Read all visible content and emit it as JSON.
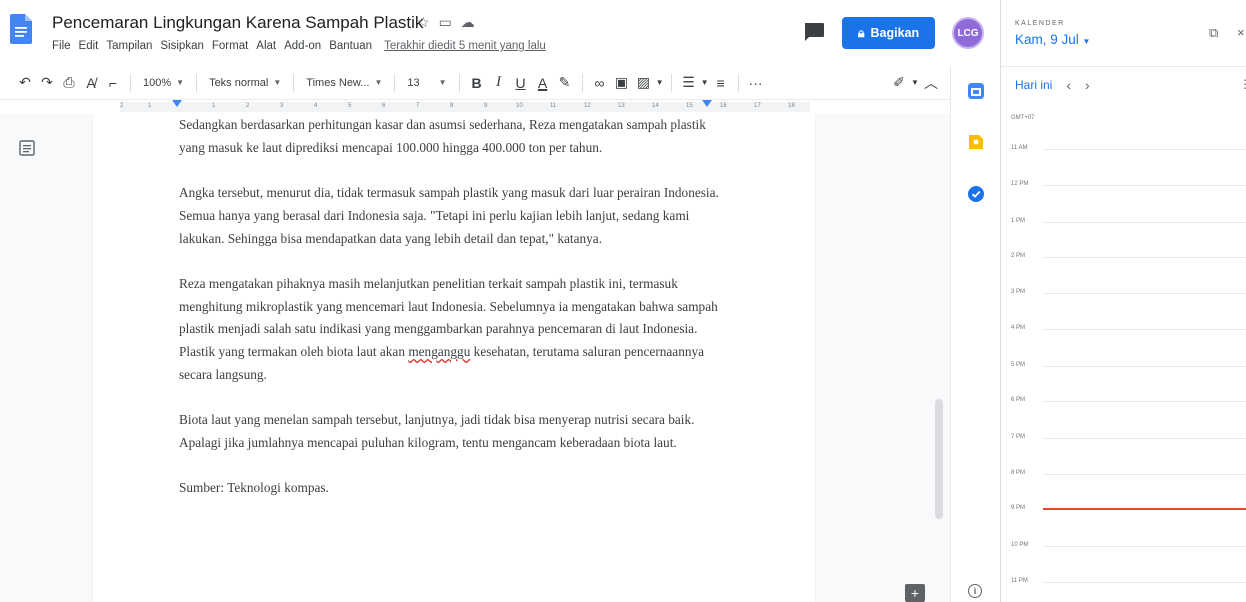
{
  "header": {
    "title": "Pencemaran Lingkungan Karena Sampah Plastik",
    "menu": [
      "File",
      "Edit",
      "Tampilan",
      "Sisipkan",
      "Format",
      "Alat",
      "Add-on",
      "Bantuan"
    ],
    "last_edit": "Terakhir diedit 5 menit yang lalu",
    "share_label": "Bagikan",
    "avatar_initials": "LCG"
  },
  "toolbar": {
    "zoom": "100%",
    "style": "Teks normal",
    "font": "Times New...",
    "font_size": "13",
    "bold": "B",
    "italic": "I",
    "underline": "U",
    "text_color": "A"
  },
  "ruler": {
    "numbers": [
      "2",
      "1",
      "1",
      "2",
      "3",
      "4",
      "5",
      "6",
      "7",
      "8",
      "9",
      "10",
      "11",
      "12",
      "13",
      "14",
      "15",
      "16",
      "17",
      "18"
    ]
  },
  "document": {
    "paragraphs": [
      "Sedangkan berdasarkan perhitungan kasar dan asumsi sederhana, Reza mengatakan sampah plastik yang masuk ke laut diprediksi mencapai 100.000 hingga 400.000 ton per tahun.",
      "Angka tersebut, menurut dia, tidak termasuk sampah plastik yang masuk dari luar perairan Indonesia. Semua hanya yang berasal dari Indonesia saja. \"Tetapi ini perlu kajian lebih lanjut, sedang kami lakukan. Sehingga bisa mendapatkan data yang lebih detail dan tepat,\" katanya.",
      "Biota laut yang menelan sampah tersebut, lanjutnya, jadi tidak bisa menyerap nutrisi secara baik. Apalagi jika jumlahnya mencapai puluhan kilogram, tentu mengancam keberadaan biota laut.",
      "Sumber: Teknologi kompas."
    ],
    "para3_before": "Reza mengatakan pihaknya masih melanjutkan penelitian terkait sampah plastik ini, termasuk menghitung mikroplastik yang mencemari laut Indonesia. Sebelumnya ia mengatakan bahwa sampah plastik menjadi salah satu indikasi yang menggambarkan parahnya pencemaran di laut Indonesia. Plastik yang termakan oleh biota laut akan ",
    "para3_misspelled": "menganggu",
    "para3_after": " kesehatan, terutama saluran pencernaannya secara langsung."
  },
  "calendar": {
    "label": "KALENDER",
    "date": "Kam, 9 Jul",
    "today": "Hari ini",
    "timezone": "GMT+07",
    "hours": [
      "11 AM",
      "12 PM",
      "1 PM",
      "2 PM",
      "3 PM",
      "4 PM",
      "5 PM",
      "6 PM",
      "7 PM",
      "8 PM",
      "9 PM",
      "10 PM",
      "11 PM"
    ]
  },
  "colors": {
    "share_blue": "#1a73e8",
    "now_line": "#ea4335",
    "keep_yellow": "#fbbc04",
    "tasks_blue": "#1a73e8",
    "calendar_blue": "#4285f4"
  }
}
